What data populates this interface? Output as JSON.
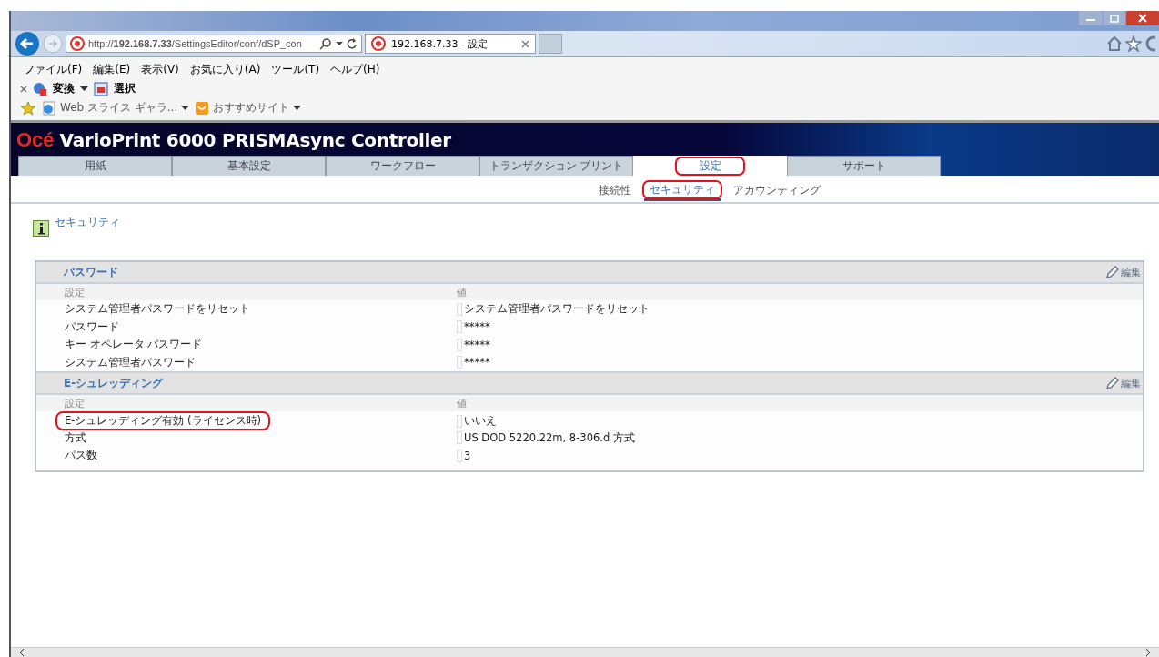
{
  "browser": {
    "address": "http://**192.168.7.33**/SettingsEditor/conf/dSP_con",
    "tab_title": "192.168.7.33 - 設定",
    "menu": [
      "ファイル(F)",
      "編集(E)",
      "表示(V)",
      "お気に入り(A)",
      "ツール(T)",
      "ヘルプ(H)"
    ],
    "command_bar": [
      "変換",
      "選択"
    ],
    "favorites": [
      "Web スライス ギャラ...",
      "おすすめサイト"
    ]
  },
  "app": {
    "brand": "Océ",
    "title": "VarioPrint 6000 PRISMAsync Controller",
    "tabs": [
      {
        "label": "用紙",
        "selected": false,
        "highlighted": false
      },
      {
        "label": "基本設定",
        "selected": false,
        "highlighted": false
      },
      {
        "label": "ワークフロー",
        "selected": false,
        "highlighted": false
      },
      {
        "label": "トランザクション プリント",
        "selected": false,
        "highlighted": false
      },
      {
        "label": "設定",
        "selected": true,
        "highlighted": true
      },
      {
        "label": "サポート",
        "selected": false,
        "highlighted": false
      }
    ],
    "subtabs": [
      {
        "label": "接続性",
        "selected": false,
        "highlighted": false
      },
      {
        "label": "セキュリティ",
        "selected": true,
        "highlighted": true
      },
      {
        "label": "アカウンティング",
        "selected": false,
        "highlighted": false
      }
    ],
    "breadcrumb": "セキュリティ",
    "sections": [
      {
        "title": "パスワード",
        "edit": "編集",
        "columns": [
          "設定",
          "値"
        ],
        "rows": [
          {
            "setting": "システム管理者パスワードをリセット",
            "value": "システム管理者パスワードをリセット",
            "highlighted": false
          },
          {
            "setting": "パスワード",
            "value": "*****",
            "highlighted": false
          },
          {
            "setting": "キー オペレータ パスワード",
            "value": "*****",
            "highlighted": false
          },
          {
            "setting": "システム管理者パスワード",
            "value": "*****",
            "highlighted": false
          }
        ]
      },
      {
        "title": "E-シュレッディング",
        "edit": "編集",
        "columns": [
          "設定",
          "値"
        ],
        "rows": [
          {
            "setting": "E-シュレッディング有効 (ライセンス時)",
            "value": "いいえ",
            "highlighted": true
          },
          {
            "setting": "方式",
            "value": "US DOD 5220.22m, 8-306.d 方式",
            "highlighted": false
          },
          {
            "setting": "パス数",
            "value": "3",
            "highlighted": false
          }
        ]
      }
    ]
  }
}
